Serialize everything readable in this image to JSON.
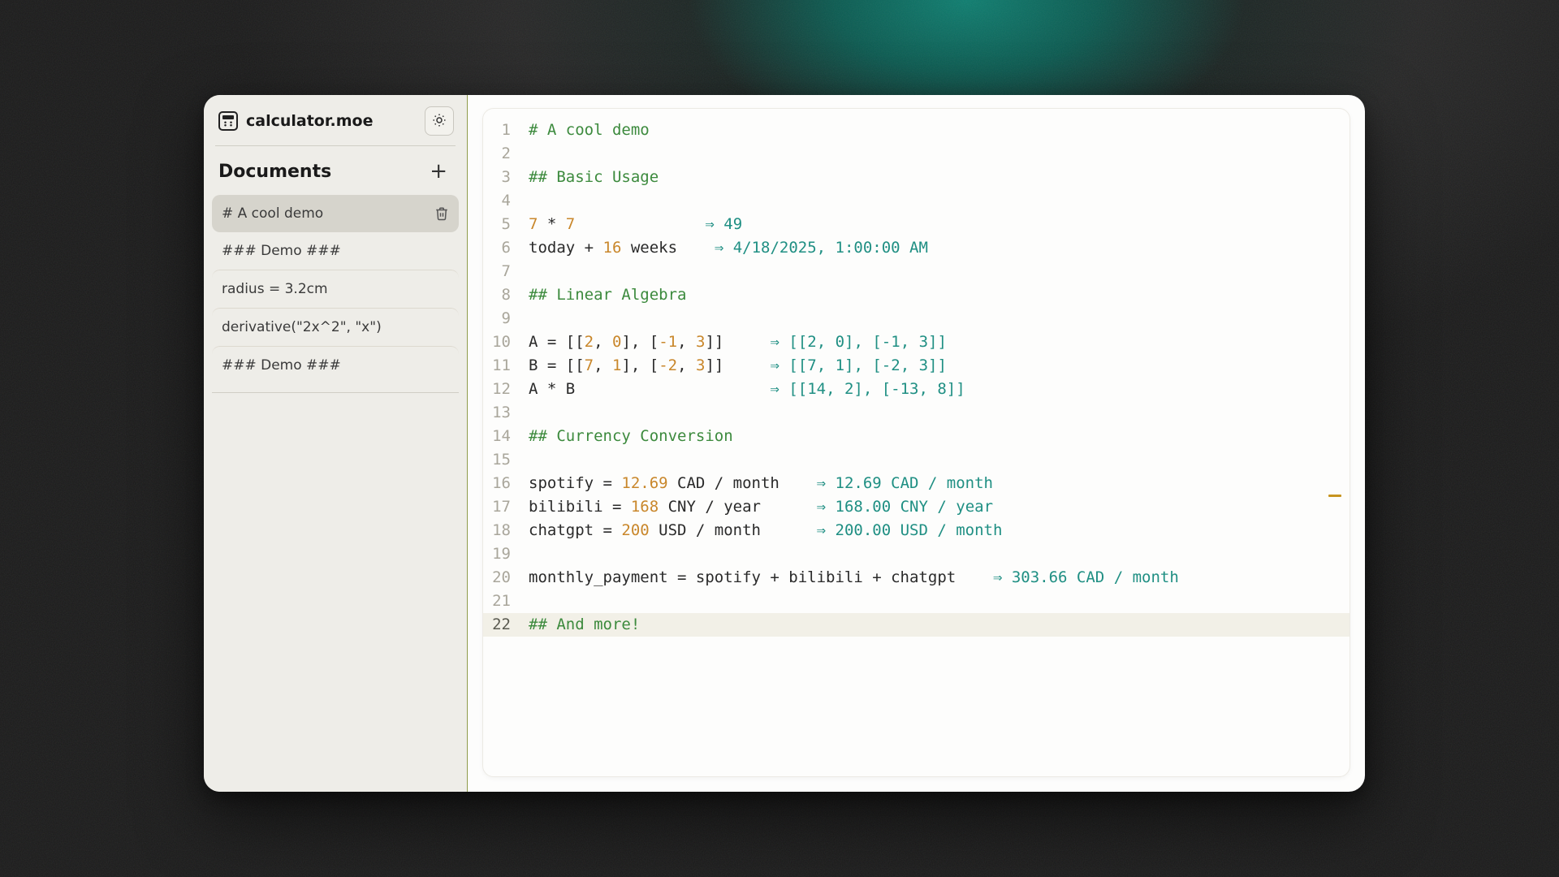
{
  "app": {
    "title": "calculator.moe"
  },
  "sidebar": {
    "section_label": "Documents",
    "items": [
      {
        "label": "# A cool demo",
        "active": true
      },
      {
        "label": "### Demo ###",
        "active": false
      },
      {
        "label": "radius = 3.2cm",
        "active": false
      },
      {
        "label": "derivative(\"2x^2\", \"x\")",
        "active": false
      },
      {
        "label": "### Demo ###",
        "active": false
      }
    ]
  },
  "editor": {
    "cursor_line": 22,
    "lines": [
      {
        "n": 1,
        "tokens": [
          {
            "t": "# A cool demo",
            "c": "hd"
          }
        ]
      },
      {
        "n": 2,
        "tokens": []
      },
      {
        "n": 3,
        "tokens": [
          {
            "t": "## Basic Usage",
            "c": "hd"
          }
        ]
      },
      {
        "n": 4,
        "tokens": []
      },
      {
        "n": 5,
        "tokens": [
          {
            "t": "7",
            "c": "num"
          },
          {
            "t": " * ",
            "c": "txt"
          },
          {
            "t": "7",
            "c": "num"
          }
        ],
        "pad": 14,
        "result": "49"
      },
      {
        "n": 6,
        "tokens": [
          {
            "t": "today + ",
            "c": "txt"
          },
          {
            "t": "16",
            "c": "num"
          },
          {
            "t": " weeks",
            "c": "txt"
          }
        ],
        "pad": 4,
        "result": "4/18/2025, 1:00:00 AM"
      },
      {
        "n": 7,
        "tokens": []
      },
      {
        "n": 8,
        "tokens": [
          {
            "t": "## Linear Algebra",
            "c": "hd"
          }
        ]
      },
      {
        "n": 9,
        "tokens": []
      },
      {
        "n": 10,
        "tokens": [
          {
            "t": "A = [[",
            "c": "txt"
          },
          {
            "t": "2",
            "c": "num"
          },
          {
            "t": ", ",
            "c": "txt"
          },
          {
            "t": "0",
            "c": "num"
          },
          {
            "t": "], [",
            "c": "txt"
          },
          {
            "t": "-1",
            "c": "num"
          },
          {
            "t": ", ",
            "c": "txt"
          },
          {
            "t": "3",
            "c": "num"
          },
          {
            "t": "]]",
            "c": "txt"
          }
        ],
        "pad": 5,
        "result": "[[2, 0], [-1, 3]]"
      },
      {
        "n": 11,
        "tokens": [
          {
            "t": "B = [[",
            "c": "txt"
          },
          {
            "t": "7",
            "c": "num"
          },
          {
            "t": ", ",
            "c": "txt"
          },
          {
            "t": "1",
            "c": "num"
          },
          {
            "t": "], [",
            "c": "txt"
          },
          {
            "t": "-2",
            "c": "num"
          },
          {
            "t": ", ",
            "c": "txt"
          },
          {
            "t": "3",
            "c": "num"
          },
          {
            "t": "]]",
            "c": "txt"
          }
        ],
        "pad": 5,
        "result": "[[7, 1], [-2, 3]]"
      },
      {
        "n": 12,
        "tokens": [
          {
            "t": "A * B",
            "c": "txt"
          }
        ],
        "pad": 21,
        "result": "[[14, 2], [-13, 8]]"
      },
      {
        "n": 13,
        "tokens": []
      },
      {
        "n": 14,
        "tokens": [
          {
            "t": "## Currency Conversion",
            "c": "hd"
          }
        ]
      },
      {
        "n": 15,
        "tokens": []
      },
      {
        "n": 16,
        "tokens": [
          {
            "t": "spotify = ",
            "c": "txt"
          },
          {
            "t": "12.69",
            "c": "num"
          },
          {
            "t": " CAD / month",
            "c": "txt"
          }
        ],
        "pad": 4,
        "result": "12.69 CAD / month"
      },
      {
        "n": 17,
        "tokens": [
          {
            "t": "bilibili = ",
            "c": "txt"
          },
          {
            "t": "168",
            "c": "num"
          },
          {
            "t": " CNY / year",
            "c": "txt"
          }
        ],
        "pad": 6,
        "result": "168.00 CNY / year"
      },
      {
        "n": 18,
        "tokens": [
          {
            "t": "chatgpt = ",
            "c": "txt"
          },
          {
            "t": "200",
            "c": "num"
          },
          {
            "t": " USD / month",
            "c": "txt"
          }
        ],
        "pad": 6,
        "result": "200.00 USD / month"
      },
      {
        "n": 19,
        "tokens": []
      },
      {
        "n": 20,
        "tokens": [
          {
            "t": "monthly_payment = spotify + bilibili + chatgpt",
            "c": "txt"
          }
        ],
        "pad": 4,
        "result": "303.66 CAD / month"
      },
      {
        "n": 21,
        "tokens": []
      },
      {
        "n": 22,
        "tokens": [
          {
            "t": "## And more!",
            "c": "hd"
          }
        ]
      }
    ]
  }
}
